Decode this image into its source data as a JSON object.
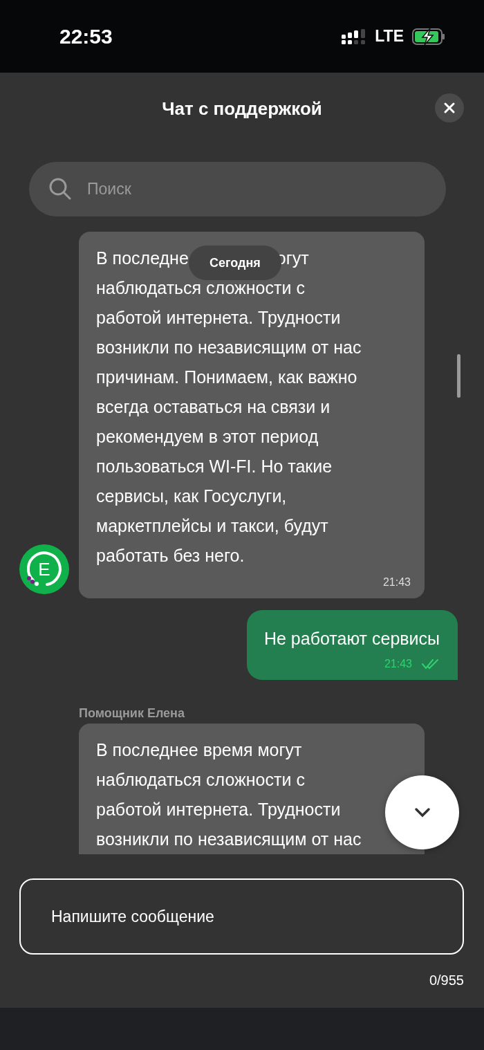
{
  "status_bar": {
    "time": "22:53",
    "network": "LTE"
  },
  "header": {
    "title": "Чат с поддержкой"
  },
  "search": {
    "placeholder": "Поиск"
  },
  "date_chip": "Сегодня",
  "messages": [
    {
      "kind": "incoming",
      "lead_left": "В последне",
      "lead_right": "огут",
      "lines": [
        "наблюдаться сложности с",
        "работой интернета. Трудности",
        "возникли по независящим от нас",
        "причинам. Понимаем, как важно",
        "всегда оставаться на связи и",
        "рекомендуем в этот период",
        "пользоваться WI-FI. Но такие",
        "сервисы, как Госуслуги,",
        "маркетплейсы и такси, будут",
        "работать без него."
      ],
      "time": "21:43",
      "avatar": "E"
    },
    {
      "kind": "outgoing",
      "lines": [
        "Не работают сервисы"
      ],
      "time": "21:43",
      "read": true
    },
    {
      "kind": "incoming",
      "sender": "Помощник Елена",
      "lines": [
        "В последнее время могут",
        "наблюдаться сложности с",
        "работой интернета. Трудности",
        "возникли по независящим от нас"
      ]
    }
  ],
  "composer": {
    "placeholder": "Напишите сообщение",
    "counter": "0/955"
  }
}
